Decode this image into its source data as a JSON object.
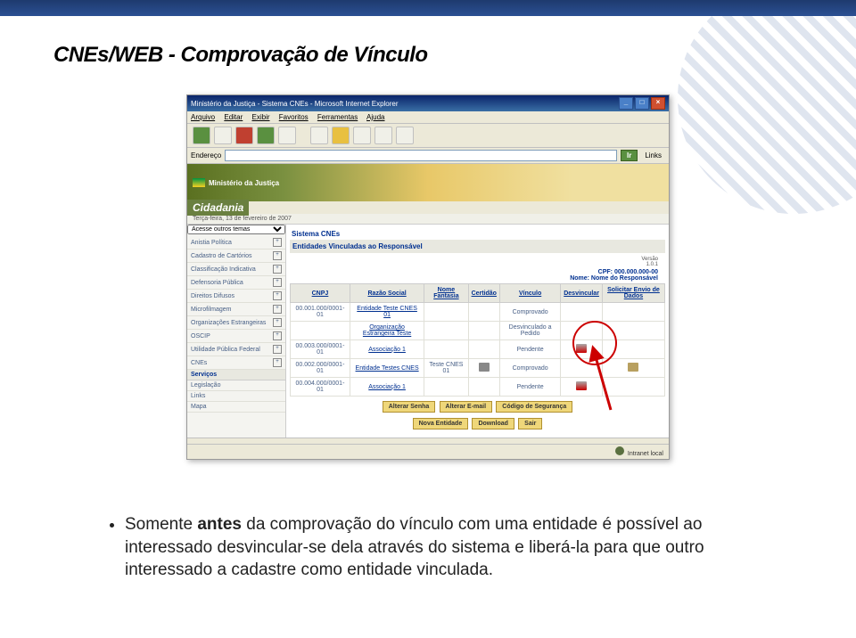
{
  "slide_title": "CNEs/WEB - Comprovação de Vínculo",
  "ie": {
    "title": "Ministério da Justiça - Sistema CNEs - Microsoft Internet Explorer",
    "menu": [
      "Arquivo",
      "Editar",
      "Exibir",
      "Favoritos",
      "Ferramentas",
      "Ajuda"
    ],
    "addr_label": "Endereço",
    "go": "Ir",
    "links": "Links"
  },
  "banner": {
    "ministry": "Ministério da Justiça",
    "section": "Cidadania"
  },
  "date": "Terça-feira, 13 de fevereiro de 2007",
  "sidebar": {
    "select_label": "Acesse outros temas",
    "items": [
      "Anistia Política",
      "Cadastro de Cartórios",
      "Classificação Indicativa",
      "Defensoria Pública",
      "Direitos Difusos",
      "Microfilmagem",
      "Organizações Estrangeiras",
      "OSCIP",
      "Utilidade Pública Federal",
      "CNEs"
    ],
    "services_header": "Serviços",
    "services_items": [
      "Legislação",
      "Links",
      "Mapa"
    ]
  },
  "main": {
    "sistema": "Sistema CNEs",
    "subtitle": "Entidades Vinculadas ao Responsável",
    "version_label": "Versão",
    "version": "1.0.1",
    "cpf_label": "CPF: 000.000.000-00",
    "name_label": "Nome: Nome do Responsável",
    "headers": [
      "CNPJ",
      "Razão Social",
      "Nome Fantasia",
      "Certidão",
      "Vínculo",
      "Desvincular",
      "Solicitar Envio de Dados"
    ],
    "rows": [
      {
        "cnpj": "00.001.000/0001-01",
        "razao": "Entidade Teste CNES 01",
        "fantasia": "",
        "certidao": "",
        "vinculo": "Comprovado",
        "desv": "",
        "envio": ""
      },
      {
        "cnpj": "",
        "razao": "Organização Estrangeira Teste",
        "fantasia": "",
        "certidao": "",
        "vinculo": "Desvinculado a Pedido",
        "desv": "",
        "envio": ""
      },
      {
        "cnpj": "00.003.000/0001-01",
        "razao": "Associação 1",
        "fantasia": "",
        "certidao": "",
        "vinculo": "Pendente",
        "desv": "x",
        "envio": ""
      },
      {
        "cnpj": "00.002.000/0001-01",
        "razao": "Entidade Testes CNES",
        "fantasia": "Teste CNES 01",
        "certidao": "print",
        "vinculo": "Comprovado",
        "desv": "",
        "envio": "env"
      },
      {
        "cnpj": "00.004.000/0001-01",
        "razao": "Associação 1",
        "fantasia": "",
        "certidao": "",
        "vinculo": "Pendente",
        "desv": "x",
        "envio": ""
      }
    ],
    "buttons_row1": [
      "Alterar Senha",
      "Alterar E-mail",
      "Código de Segurança"
    ],
    "buttons_row2": [
      "Nova Entidade",
      "Download",
      "Sair"
    ]
  },
  "status": "Intranet local",
  "caption": {
    "bold1": "antes",
    "text": " Somente antes da comprovação do vínculo com uma entidade é possível ao interessado desvincular-se dela através do sistema e liberá-la para que outro interessado a cadastre como entidade vinculada."
  }
}
